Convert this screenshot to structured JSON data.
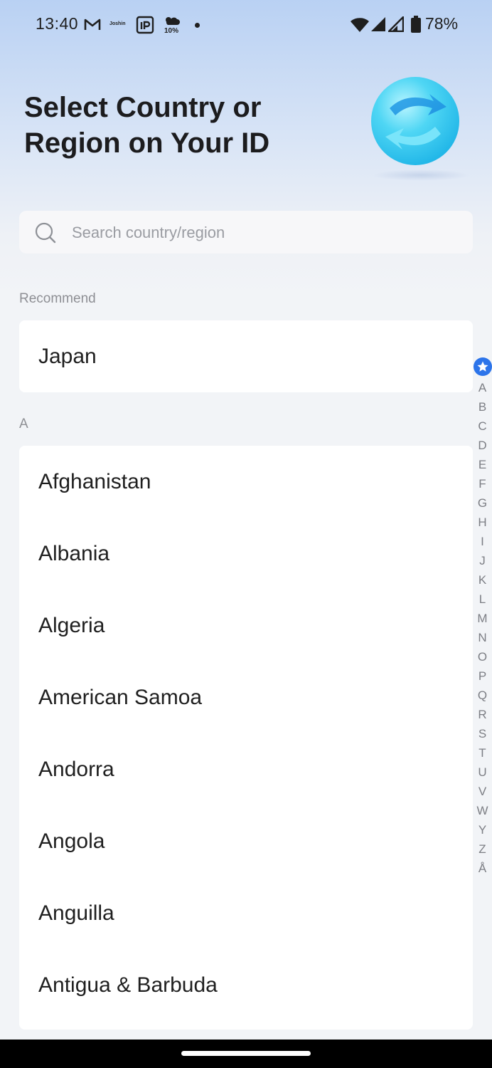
{
  "status_bar": {
    "time": "13:40",
    "notification_text": "Joshin",
    "weather_percent": "10%",
    "battery_percent": "78%"
  },
  "header": {
    "title": "Select Country or\nRegion on Your ID"
  },
  "search": {
    "placeholder": "Search country/region"
  },
  "recommend": {
    "label": "Recommend",
    "items": [
      "Japan"
    ]
  },
  "section_a": {
    "label": "A",
    "items": [
      "Afghanistan",
      "Albania",
      "Algeria",
      "American Samoa",
      "Andorra",
      "Angola",
      "Anguilla",
      "Antigua & Barbuda"
    ]
  },
  "index_bar": {
    "letters": [
      "A",
      "B",
      "C",
      "D",
      "E",
      "F",
      "G",
      "H",
      "I",
      "J",
      "K",
      "L",
      "M",
      "N",
      "O",
      "P",
      "Q",
      "R",
      "S",
      "T",
      "U",
      "V",
      "W",
      "Y",
      "Z",
      "Å"
    ],
    "accent_color": "#2c74ea"
  },
  "icons": {
    "status": [
      "gmail-icon",
      "joshin-icon",
      "ip-icon",
      "weather-icon",
      "wifi-icon",
      "signal-icon",
      "battery-icon"
    ],
    "header": "globe-icon",
    "search": "search-icon",
    "index": "star-icon"
  }
}
